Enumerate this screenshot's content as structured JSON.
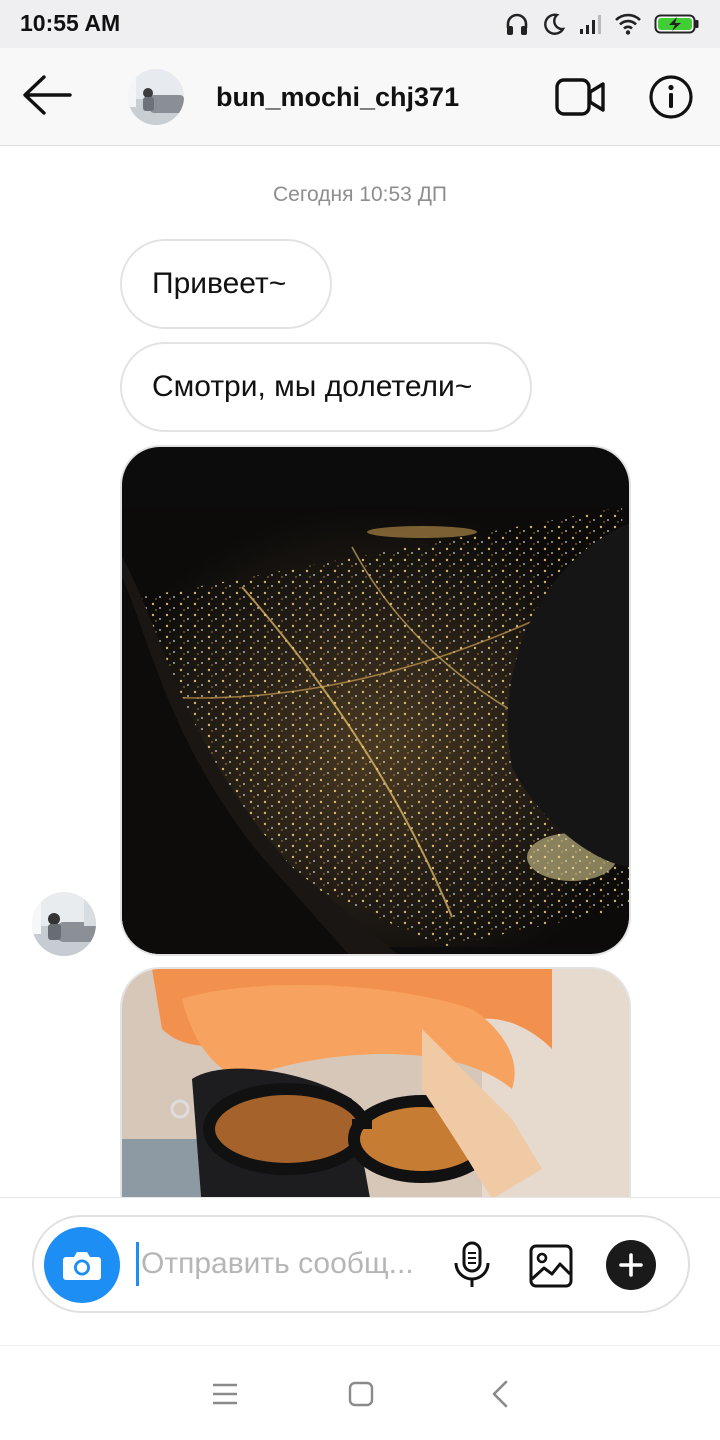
{
  "status_bar": {
    "time": "10:55 AM",
    "icons": [
      "headphones-icon",
      "moon-icon",
      "signal-icon",
      "wifi-icon",
      "battery-charging-icon"
    ]
  },
  "header": {
    "username": "bun_mochi_chj371",
    "icons": [
      "back-arrow-icon",
      "video-camera-icon",
      "info-icon"
    ]
  },
  "chat": {
    "timestamp": "Сегодня 10:53 ДП",
    "messages": [
      {
        "type": "text",
        "text": "Привеет~"
      },
      {
        "type": "text",
        "text": "Смотри, мы долетели~"
      },
      {
        "type": "image",
        "description": "night-city-from-airplane-window"
      },
      {
        "type": "image",
        "description": "orange-hair-sunglasses-mask"
      }
    ]
  },
  "composer": {
    "placeholder": "Отправить сообщ...",
    "value": "",
    "icons": [
      "camera-icon",
      "microphone-icon",
      "gallery-icon",
      "plus-icon"
    ],
    "accent_color": "#1d8ef4"
  },
  "nav_bar": {
    "icons": [
      "menu-icon",
      "home-icon",
      "back-icon"
    ]
  }
}
